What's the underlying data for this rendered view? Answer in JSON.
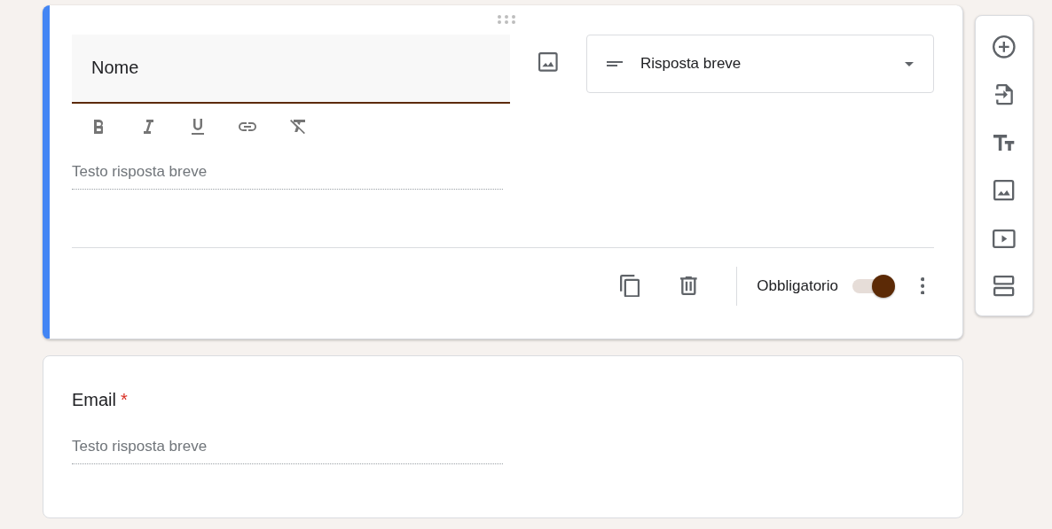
{
  "questions": [
    {
      "title": "Nome",
      "active": true,
      "type_label": "Risposta breve",
      "answer_placeholder": "Testo risposta breve",
      "required_label": "Obbligatorio",
      "required": true
    },
    {
      "title": "Email",
      "active": false,
      "required": true,
      "required_mark": "*",
      "answer_placeholder": "Testo risposta breve"
    }
  ]
}
